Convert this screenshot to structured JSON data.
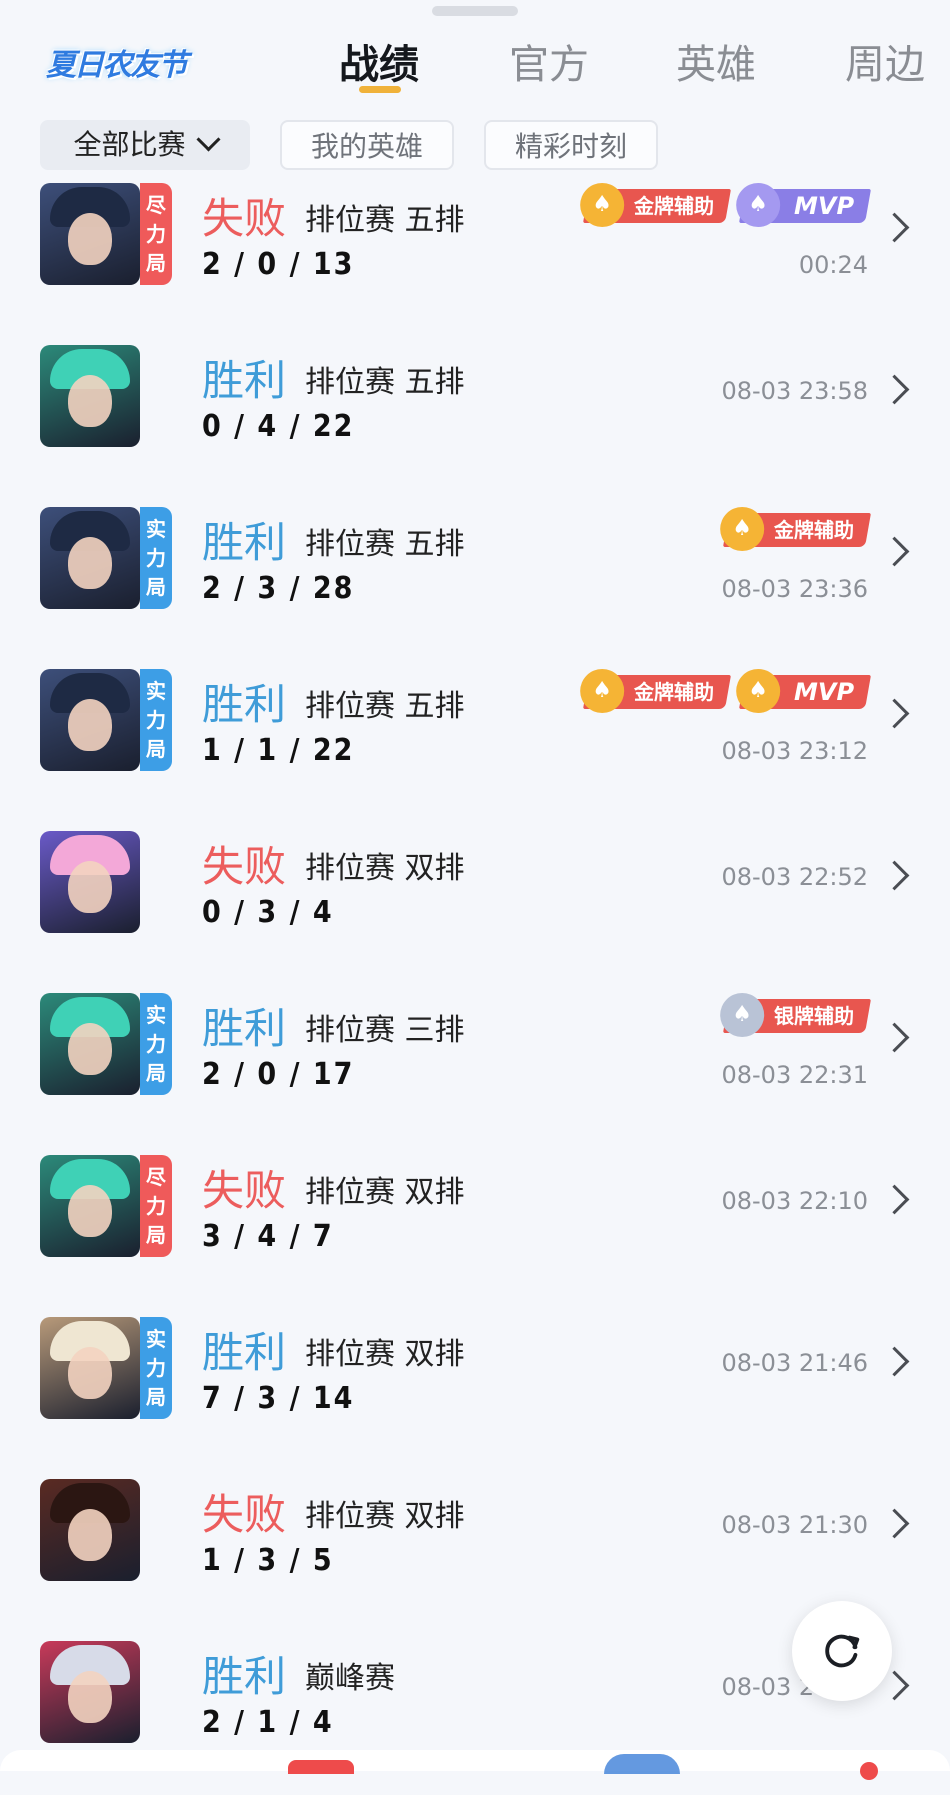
{
  "header": {
    "logo_text": "夏日农友节",
    "tabs": [
      {
        "label": "战绩",
        "active": true
      },
      {
        "label": "官方",
        "active": false
      },
      {
        "label": "英雄",
        "active": false
      },
      {
        "label": "周边",
        "active": false
      }
    ]
  },
  "filters": {
    "match_type": "全部比赛",
    "my_heroes": "我的英雄",
    "highlights": "精彩时刻"
  },
  "matches": [
    {
      "result": "失败",
      "outcome": "lose",
      "mode": "排位赛 五排",
      "kda": "2 / 0 / 13",
      "time": "00:24",
      "badge": [
        "尽",
        "力",
        "局"
      ],
      "badge_color": "red",
      "tags": [
        {
          "text": "金牌辅助",
          "kind": "gold"
        },
        {
          "text": "MVP",
          "kind": "mvp-purple"
        }
      ],
      "hero_color": "#3d4f7a",
      "hair_color": "#1e2a44"
    },
    {
      "result": "胜利",
      "outcome": "win",
      "mode": "排位赛 五排",
      "kda": "0 / 4 / 22",
      "time": "08-03 23:58",
      "badge": [],
      "badge_color": "",
      "tags": [],
      "hero_color": "#2c8a7a",
      "hair_color": "#3fd1b6"
    },
    {
      "result": "胜利",
      "outcome": "win",
      "mode": "排位赛 五排",
      "kda": "2 / 3 / 28",
      "time": "08-03 23:36",
      "badge": [
        "实",
        "力",
        "局"
      ],
      "badge_color": "blue",
      "tags": [
        {
          "text": "金牌辅助",
          "kind": "gold"
        }
      ],
      "hero_color": "#3d4f7a",
      "hair_color": "#1e2a44"
    },
    {
      "result": "胜利",
      "outcome": "win",
      "mode": "排位赛 五排",
      "kda": "1 / 1 / 22",
      "time": "08-03 23:12",
      "badge": [
        "实",
        "力",
        "局"
      ],
      "badge_color": "blue",
      "tags": [
        {
          "text": "金牌辅助",
          "kind": "gold"
        },
        {
          "text": "MVP",
          "kind": "mvp-red"
        }
      ],
      "hero_color": "#3d4f7a",
      "hair_color": "#1e2a44"
    },
    {
      "result": "失败",
      "outcome": "lose",
      "mode": "排位赛 双排",
      "kda": "0 / 3 / 4",
      "time": "08-03 22:52",
      "badge": [],
      "badge_color": "",
      "tags": [],
      "hero_color": "#6a5ac8",
      "hair_color": "#f3a8d8"
    },
    {
      "result": "胜利",
      "outcome": "win",
      "mode": "排位赛 三排",
      "kda": "2 / 0 / 17",
      "time": "08-03 22:31",
      "badge": [
        "实",
        "力",
        "局"
      ],
      "badge_color": "blue",
      "tags": [
        {
          "text": "银牌辅助",
          "kind": "silver"
        }
      ],
      "hero_color": "#2c8a7a",
      "hair_color": "#3fd1b6"
    },
    {
      "result": "失败",
      "outcome": "lose",
      "mode": "排位赛 双排",
      "kda": "3 / 4 / 7",
      "time": "08-03 22:10",
      "badge": [
        "尽",
        "力",
        "局"
      ],
      "badge_color": "red",
      "tags": [],
      "hero_color": "#2c8a7a",
      "hair_color": "#3fd1b6"
    },
    {
      "result": "胜利",
      "outcome": "win",
      "mode": "排位赛 双排",
      "kda": "7 / 3 / 14",
      "time": "08-03 21:46",
      "badge": [
        "实",
        "力",
        "局"
      ],
      "badge_color": "blue",
      "tags": [],
      "hero_color": "#b89a7a",
      "hair_color": "#efe6d2"
    },
    {
      "result": "失败",
      "outcome": "lose",
      "mode": "排位赛 双排",
      "kda": "1 / 3 / 5",
      "time": "08-03 21:30",
      "badge": [],
      "badge_color": "",
      "tags": [],
      "hero_color": "#5a2a22",
      "hair_color": "#2b1612"
    },
    {
      "result": "胜利",
      "outcome": "win",
      "mode": "巅峰赛",
      "kda": "2 / 1 / 4",
      "time": "08-03 20:28",
      "badge": [],
      "badge_color": "",
      "tags": [],
      "hero_color": "#c83a5a",
      "hair_color": "#d7dbe8"
    }
  ]
}
